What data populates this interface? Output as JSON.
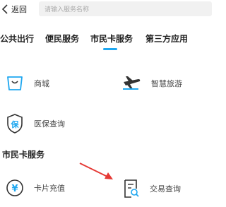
{
  "header": {
    "back_label": "返回",
    "search_placeholder": "请输入服务名称"
  },
  "tabs": [
    {
      "label": "公共出行"
    },
    {
      "label": "便民服务"
    },
    {
      "label": "市民卡服务",
      "active": true
    },
    {
      "label": "第三方应用"
    }
  ],
  "services": [
    {
      "label": "商城",
      "icon": "shopping-bag-icon"
    },
    {
      "label": "智慧旅游",
      "icon": "airplane-icon"
    },
    {
      "label": "医保查询",
      "icon": "medical-shield-icon"
    }
  ],
  "section": {
    "title": "市民卡服务",
    "items": [
      {
        "label": "卡片充值",
        "icon": "yuan-coin-icon"
      },
      {
        "label": "交易查询",
        "icon": "document-search-icon"
      }
    ]
  },
  "colors": {
    "accent": "#1ea7f0",
    "annotation_arrow": "#e53935"
  }
}
